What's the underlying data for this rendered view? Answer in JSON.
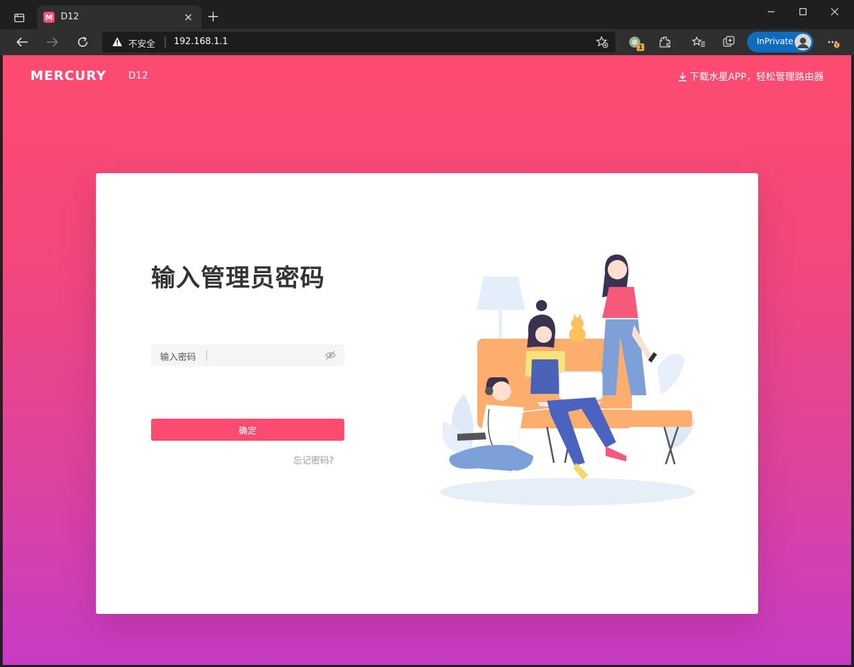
{
  "browser": {
    "tab_title": "D12",
    "tab_favicon_letter": "M",
    "security_label": "不安全",
    "url": "192.168.1.1",
    "inprivate_label": "InPrivate",
    "extension_badge": "1"
  },
  "header": {
    "brand": "MERCURY",
    "model": "D12",
    "download_link": "下载水星APP，轻松管理路由器"
  },
  "login": {
    "title": "输入管理员密码",
    "password_label": "输入密码",
    "password_value": "",
    "confirm_label": "确定",
    "forgot_label": "忘记密码?"
  },
  "colors": {
    "accent": "#fc4b71",
    "gradient_top": "#fd4a70",
    "gradient_bottom": "#c73cc6",
    "inprivate": "#0f6cbd"
  }
}
